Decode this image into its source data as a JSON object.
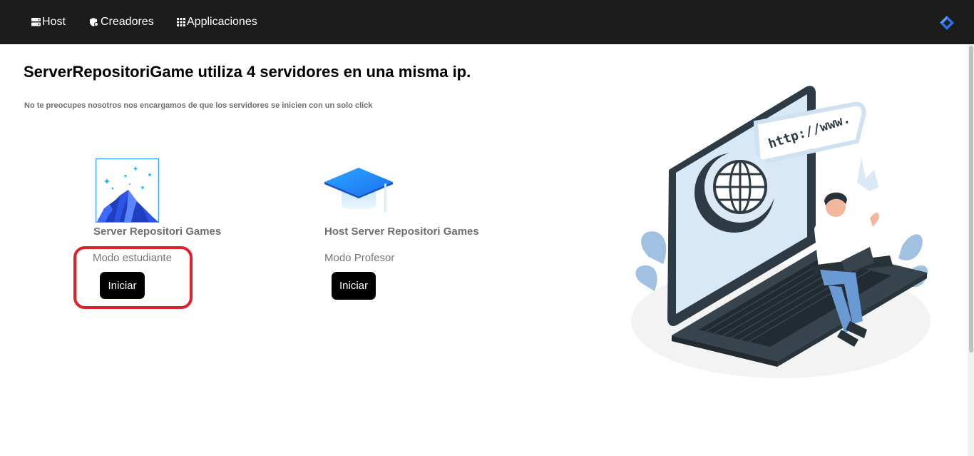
{
  "nav": {
    "host": "Host",
    "creadores": "Creadores",
    "aplicaciones": "Applicaciones"
  },
  "main": {
    "title": "ServerRepositoriGame utiliza 4 servidores en una misma ip.",
    "subtitle": "No te preocupes nosotros nos encargamos de que los servidores se inicien con un solo click"
  },
  "cards": [
    {
      "title": "Server Repositori Games",
      "mode": "Modo estudiante",
      "button": "Iniciar",
      "icon": "mountain-stars-icon"
    },
    {
      "title": "Host Server Repositori Games",
      "mode": "Modo Profesor",
      "button": "Iniciar",
      "icon": "graduation-cap-icon"
    }
  ],
  "illustration": {
    "url_text": "http://www."
  },
  "colors": {
    "navbar": "#1c1c1c",
    "highlight": "#e0202a",
    "button": "#000000",
    "accent_blue": "#2f6fe4"
  }
}
